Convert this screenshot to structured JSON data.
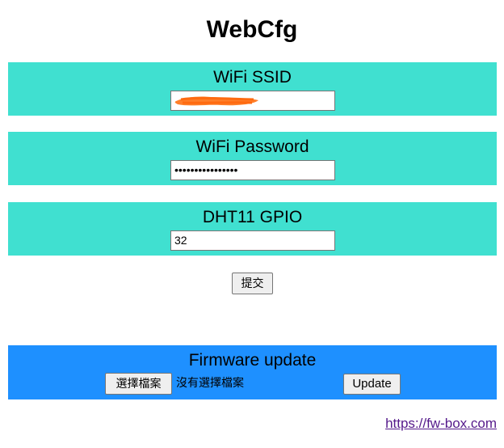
{
  "page": {
    "title": "WebCfg"
  },
  "fields": {
    "ssid": {
      "label": "WiFi SSID",
      "value": ""
    },
    "password": {
      "label": "WiFi Password",
      "masked_value": "••••••••••••••••"
    },
    "gpio": {
      "label": "DHT11 GPIO",
      "value": "32"
    }
  },
  "submit": {
    "label": "提交"
  },
  "firmware": {
    "title": "Firmware update",
    "choose_file_label": "選擇檔案",
    "file_status": "沒有選擇檔案",
    "update_label": "Update"
  },
  "footer": {
    "link_text": "https://fw-box.com"
  },
  "colors": {
    "config_block": "#40e0d0",
    "firmware_block": "#1e90ff",
    "link": "#551a8b",
    "redaction": "#ff7f2a"
  },
  "icons": {
    "redaction": "orange-scribble"
  }
}
